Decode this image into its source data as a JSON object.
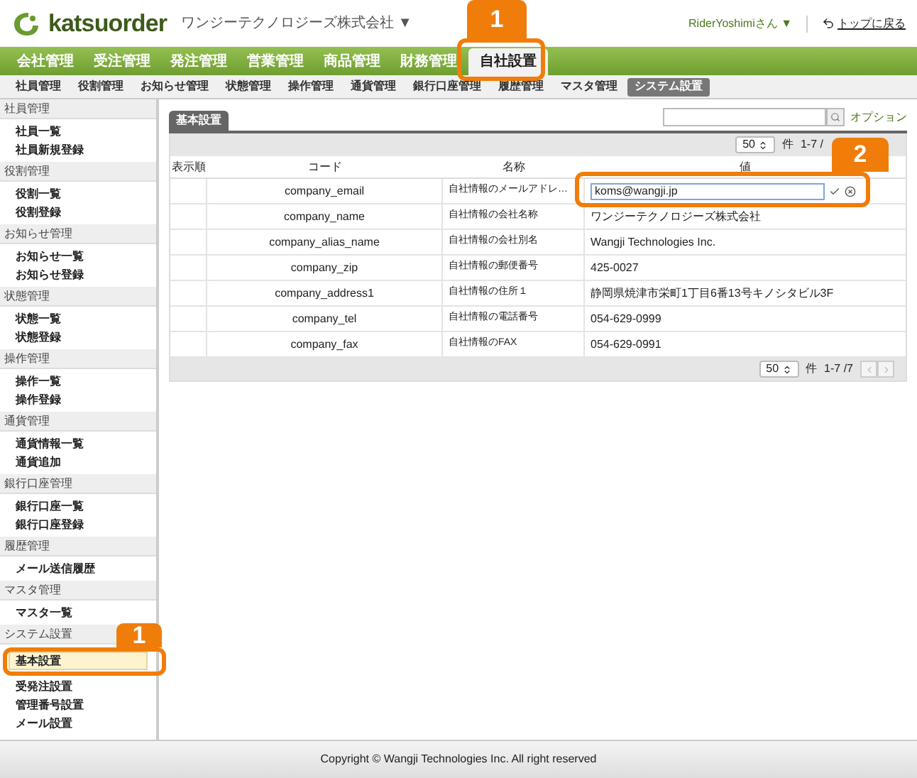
{
  "header": {
    "logo": "katsuorder",
    "company": "ワンジーテクノロジーズ株式会社 ▼",
    "user": "RiderYoshimiさん ▼",
    "top_link": "トップに戻る"
  },
  "nav": [
    {
      "label": "会社管理",
      "selected": false
    },
    {
      "label": "受注管理",
      "selected": false
    },
    {
      "label": "発注管理",
      "selected": false
    },
    {
      "label": "営業管理",
      "selected": false
    },
    {
      "label": "商品管理",
      "selected": false
    },
    {
      "label": "財務管理",
      "selected": false
    },
    {
      "label": "自社設置",
      "selected": true
    }
  ],
  "subnav": [
    {
      "label": "社員管理",
      "selected": false
    },
    {
      "label": "役割管理",
      "selected": false
    },
    {
      "label": "お知らせ管理",
      "selected": false
    },
    {
      "label": "状態管理",
      "selected": false
    },
    {
      "label": "操作管理",
      "selected": false
    },
    {
      "label": "通貨管理",
      "selected": false
    },
    {
      "label": "銀行口座管理",
      "selected": false
    },
    {
      "label": "履歴管理",
      "selected": false
    },
    {
      "label": "マスタ管理",
      "selected": false
    },
    {
      "label": "システム設置",
      "selected": true
    }
  ],
  "sidebar": [
    {
      "title": "社員管理",
      "items": [
        {
          "label": "社員一覧",
          "selected": false
        },
        {
          "label": "社員新規登録",
          "selected": false
        }
      ]
    },
    {
      "title": "役割管理",
      "items": [
        {
          "label": "役割一覧",
          "selected": false
        },
        {
          "label": "役割登録",
          "selected": false
        }
      ]
    },
    {
      "title": "お知らせ管理",
      "items": [
        {
          "label": "お知らせ一覧",
          "selected": false
        },
        {
          "label": "お知らせ登録",
          "selected": false
        }
      ]
    },
    {
      "title": "状態管理",
      "items": [
        {
          "label": "状態一覧",
          "selected": false
        },
        {
          "label": "状態登録",
          "selected": false
        }
      ]
    },
    {
      "title": "操作管理",
      "items": [
        {
          "label": "操作一覧",
          "selected": false
        },
        {
          "label": "操作登録",
          "selected": false
        }
      ]
    },
    {
      "title": "通貨管理",
      "items": [
        {
          "label": "通貨情報一覧",
          "selected": false
        },
        {
          "label": "通貨追加",
          "selected": false
        }
      ]
    },
    {
      "title": "銀行口座管理",
      "items": [
        {
          "label": "銀行口座一覧",
          "selected": false
        },
        {
          "label": "銀行口座登録",
          "selected": false
        }
      ]
    },
    {
      "title": "履歴管理",
      "items": [
        {
          "label": "メール送信履歴",
          "selected": false
        }
      ]
    },
    {
      "title": "マスタ管理",
      "items": [
        {
          "label": "マスタ一覧",
          "selected": false
        }
      ]
    },
    {
      "title": "システム設置",
      "items": [
        {
          "label": "基本設置",
          "selected": true
        },
        {
          "label": "受発注設置",
          "selected": false
        },
        {
          "label": "管理番号設置",
          "selected": false
        },
        {
          "label": "メール設置",
          "selected": false
        }
      ]
    }
  ],
  "main": {
    "tab": "基本設置",
    "option_link": "オプション",
    "top_pager": {
      "per_page": "50",
      "unit": "件",
      "range": "1-7 /"
    },
    "columns": [
      "表示順",
      "コード",
      "名称",
      "値"
    ],
    "rows": [
      {
        "kind": "editing",
        "code": "company_email",
        "name": "自社情報のメールアドレ…",
        "value": "koms@wangji.jp"
      },
      {
        "kind": "text",
        "code": "company_name",
        "name": "自社情報の会社名称",
        "value": "ワンジーテクノロジーズ株式会社"
      },
      {
        "kind": "text",
        "code": "company_alias_name",
        "name": "自社情報の会社別名",
        "value": "Wangji Technologies Inc."
      },
      {
        "kind": "text",
        "code": "company_zip",
        "name": "自社情報の郵便番号",
        "value": "425-0027"
      },
      {
        "kind": "text",
        "code": "company_address1",
        "name": "自社情報の住所１",
        "value": "静岡県焼津市栄町1丁目6番13号キノシタビル3F"
      },
      {
        "kind": "text",
        "code": "company_tel",
        "name": "自社情報の電話番号",
        "value": "054-629-0999"
      },
      {
        "kind": "text",
        "code": "company_fax",
        "name": "自社情報のFAX",
        "value": "054-629-0991"
      }
    ],
    "bottom_pager": {
      "per_page": "50",
      "unit": "件",
      "range": "1-7 /7"
    }
  },
  "footer": "Copyright © Wangji Technologies Inc. All right reserved",
  "callouts": [
    {
      "label": "1"
    },
    {
      "label": "2"
    },
    {
      "label": "1"
    }
  ]
}
